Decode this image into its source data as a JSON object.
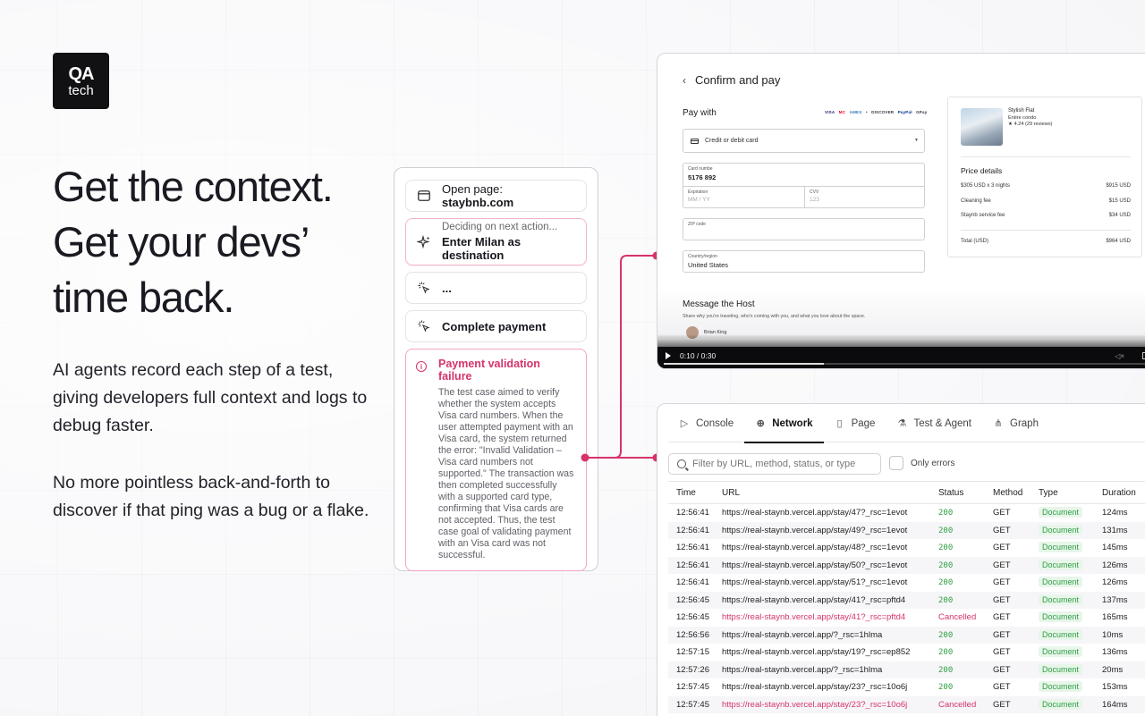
{
  "brand": {
    "line1": "QA",
    "line2": "tech"
  },
  "headline": [
    "Get the context.",
    "Get your devs’",
    "time back."
  ],
  "paragraph1": "AI agents record each step of a test, giving developers full context and logs to debug faster.",
  "paragraph2": "No more pointless back-and-forth to discover if that ping was a bug or a flake.",
  "steps": {
    "open_prefix": "Open page: ",
    "open_target": "staybnb.com",
    "deciding_label": "Deciding on next action...",
    "deciding_action": "Enter Milan as destination",
    "ellipsis": "...",
    "complete": "Complete payment",
    "failure_title": "Payment validation failure",
    "failure_body": "The test case aimed to verify whether the system accepts Visa card numbers. When the user attempted payment with an Visa card, the system returned the error: \"Invalid Validation – Visa card numbers not supported.\" The transaction was then completed successfully with a supported card type, confirming that Visa cards are not accepted. Thus, the test case goal of validating payment with an Visa card was not successful."
  },
  "checkout": {
    "back": "‹",
    "title": "Confirm and pay",
    "pay_with": "Pay with",
    "card_brands": [
      "VISA",
      "MC",
      "AMEX",
      "•",
      "DISCOVER",
      "PayPal",
      "GPay"
    ],
    "method": "Credit or debit card",
    "card_label": "Card numbe",
    "card_value": "5176 892",
    "exp_label": "Expiration",
    "exp_placeholder": "MM / YY",
    "cvv_label": "CVV",
    "cvv_placeholder": "123",
    "zip_label": "ZIP code",
    "country_label": "Country/region",
    "country_value": "United States",
    "message_title": "Message the Host",
    "message_sub": "Share why you're traveling, who's coming with you, and what you love about the space.",
    "host_name": "Brian King",
    "listing_title": "Stylish Flat",
    "listing_type": "Entire condo",
    "listing_rating": "★ 4.24 (29 reviews)",
    "price_title": "Price details",
    "price_rows": [
      {
        "label": "$305 USD x 3 nights",
        "value": "$915 USD"
      },
      {
        "label": "Cleaning fee",
        "value": "$15 USD"
      },
      {
        "label": "Staynb service fee",
        "value": "$34 USD"
      }
    ],
    "total_label": "Total (USD)",
    "total_value": "$964 USD",
    "video_time": "0:10 / 0:30",
    "video_progress": 0.33
  },
  "network": {
    "tabs": [
      {
        "label": "Console",
        "icon": "console-icon",
        "glyph": "▷"
      },
      {
        "label": "Network",
        "icon": "globe-icon",
        "glyph": "⊕",
        "active": true
      },
      {
        "label": "Page",
        "icon": "book-icon",
        "glyph": "▯"
      },
      {
        "label": "Test & Agent",
        "icon": "flask-icon",
        "glyph": "⚗"
      },
      {
        "label": "Graph",
        "icon": "graph-icon",
        "glyph": "⋔"
      }
    ],
    "search_placeholder": "Filter by URL, method, status, or type",
    "only_errors": "Only errors",
    "columns": [
      "Time",
      "URL",
      "Status",
      "Method",
      "Type",
      "Duration"
    ],
    "rows": [
      [
        "12:56:41",
        "https://real-staynb.vercel.app/stay/47?_rsc=1evot",
        "200",
        "GET",
        "Document",
        "124ms"
      ],
      [
        "12:56:41",
        "https://real-staynb.vercel.app/stay/49?_rsc=1evot",
        "200",
        "GET",
        "Document",
        "131ms"
      ],
      [
        "12:56:41",
        "https://real-staynb.vercel.app/stay/48?_rsc=1evot",
        "200",
        "GET",
        "Document",
        "145ms"
      ],
      [
        "12:56:41",
        "https://real-staynb.vercel.app/stay/50?_rsc=1evot",
        "200",
        "GET",
        "Document",
        "126ms"
      ],
      [
        "12:56:41",
        "https://real-staynb.vercel.app/stay/51?_rsc=1evot",
        "200",
        "GET",
        "Document",
        "126ms"
      ],
      [
        "12:56:45",
        "https://real-staynb.vercel.app/stay/41?_rsc=pftd4",
        "200",
        "GET",
        "Document",
        "137ms"
      ],
      [
        "12:56:45",
        "https://real-staynb.vercel.app/stay/41?_rsc=pftd4",
        "Cancelled",
        "GET",
        "Document",
        "165ms"
      ],
      [
        "12:56:56",
        "https://real-staynb.vercel.app/?_rsc=1hlma",
        "200",
        "GET",
        "Document",
        "10ms"
      ],
      [
        "12:57:15",
        "https://real-staynb.vercel.app/stay/19?_rsc=ep852",
        "200",
        "GET",
        "Document",
        "136ms"
      ],
      [
        "12:57:26",
        "https://real-staynb.vercel.app/?_rsc=1hlma",
        "200",
        "GET",
        "Document",
        "20ms"
      ],
      [
        "12:57:45",
        "https://real-staynb.vercel.app/stay/23?_rsc=10o6j",
        "200",
        "GET",
        "Document",
        "153ms"
      ],
      [
        "12:57:45",
        "https://real-staynb.vercel.app/stay/23?_rsc=10o6j",
        "Cancelled",
        "GET",
        "Document",
        "164ms"
      ]
    ]
  },
  "colors": {
    "accent": "#d6336c",
    "success": "#2f9e44",
    "ink": "#111114"
  }
}
